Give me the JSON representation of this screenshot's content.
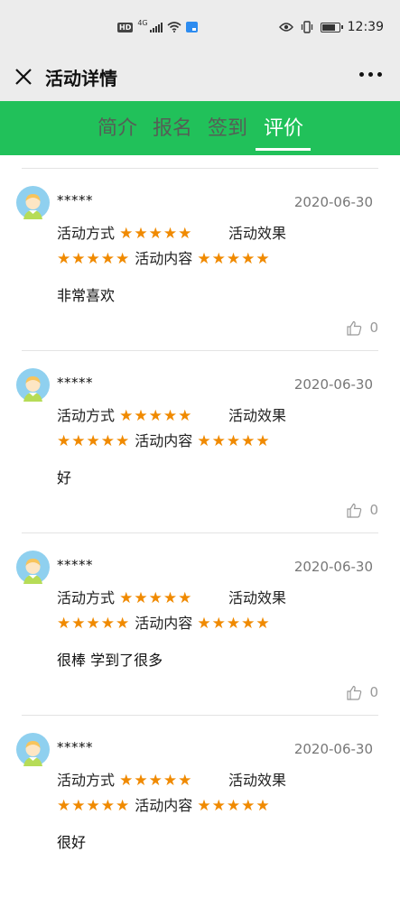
{
  "status_bar": {
    "hd": "HD",
    "network": "4G",
    "time": "12:39"
  },
  "header": {
    "title": "活动详情"
  },
  "tabs": [
    {
      "label": "简介",
      "active": false
    },
    {
      "label": "报名",
      "active": false
    },
    {
      "label": "签到",
      "active": false
    },
    {
      "label": "评价",
      "active": true
    }
  ],
  "labels": {
    "method": "活动方式",
    "effect": "活动效果",
    "content": "活动内容"
  },
  "reviews": [
    {
      "user": "*****",
      "date": "2020-06-30",
      "method_stars": "★★★★★",
      "effect_stars": "★★★★★",
      "content_stars": "★★★★★",
      "comment": "非常喜欢",
      "likes": "0"
    },
    {
      "user": "*****",
      "date": "2020-06-30",
      "method_stars": "★★★★★",
      "effect_stars": "★★★★★",
      "content_stars": "★★★★★",
      "comment": "好",
      "likes": "0"
    },
    {
      "user": "*****",
      "date": "2020-06-30",
      "method_stars": "★★★★★",
      "effect_stars": "★★★★★",
      "content_stars": "★★★★★",
      "comment": "很棒 学到了很多",
      "likes": "0"
    },
    {
      "user": "*****",
      "date": "2020-06-30",
      "method_stars": "★★★★★",
      "effect_stars": "★★★★★",
      "content_stars": "★★★★★",
      "comment": "很好",
      "likes": ""
    }
  ],
  "colors": {
    "tab_bar": "#21c15a",
    "star": "#f08a00"
  },
  "icons": {
    "close": "close-icon",
    "more": "more-icon",
    "avatar": "avatar-icon",
    "like": "thumbs-up-icon"
  }
}
